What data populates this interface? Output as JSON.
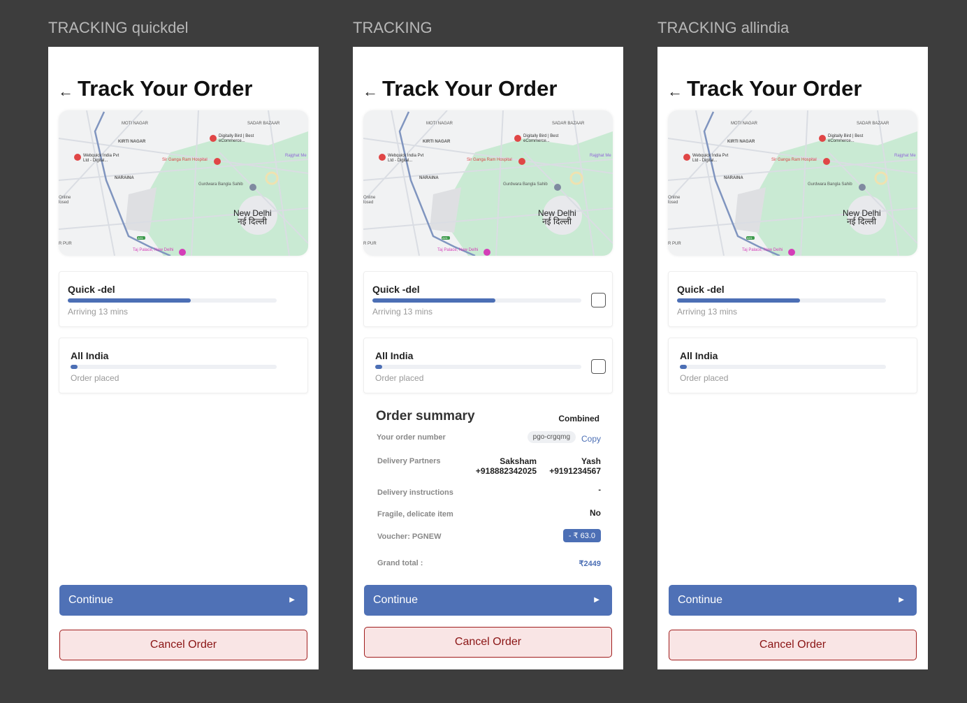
{
  "frames": [
    {
      "label": "TRACKING quickdel"
    },
    {
      "label": "TRACKING"
    },
    {
      "label": "TRACKING allindia"
    }
  ],
  "screen": {
    "title": "Track Your Order",
    "back_icon": "arrow-left-icon",
    "continue_label": "Continue",
    "cancel_label": "Cancel Order"
  },
  "map": {
    "labels": [
      "MOTI NAGAR",
      "KIRTI NAGAR",
      "SADAR BAZAAR",
      "Digitally Bird | Best eCommerce...",
      "Webquick India Pvt Ltd - Digital...",
      "Sir Ganga Ram Hospital",
      "Rajghat Me",
      "NARAINA",
      "Gurdwara Bangla Sahib",
      "Online losed",
      "New Delhi",
      "नई दिल्ली",
      "Taj Palace, New Delhi",
      "R PUR",
      "AH1"
    ]
  },
  "shipments": [
    {
      "name": "Quick -del",
      "status": "Arriving 13 mins",
      "progress": 0.59
    },
    {
      "name": "All India",
      "status": "Order placed",
      "progress": 0.03
    }
  ],
  "summary": {
    "title": "Order summary",
    "mode": "Combined",
    "order_number_label": "Your order number",
    "order_number": "pgo-crgqmg",
    "copy_label": "Copy",
    "partners_label": "Delivery Partners",
    "partners": [
      {
        "name": "Saksham",
        "phone": "+918882342025"
      },
      {
        "name": "Yash",
        "phone": "+9191234567"
      }
    ],
    "instructions_label": "Delivery instructions",
    "instructions": "-",
    "fragile_label": "Fragile, delicate item",
    "fragile": "No",
    "voucher_label": "Voucher: PGNEW",
    "voucher_value": "- ₹ 63.0",
    "total_label": "Grand total :",
    "total": "₹2449"
  },
  "colors": {
    "accent": "#4f71b6",
    "cancel_bg": "#f9e5e5",
    "cancel_text": "#8a1414"
  }
}
